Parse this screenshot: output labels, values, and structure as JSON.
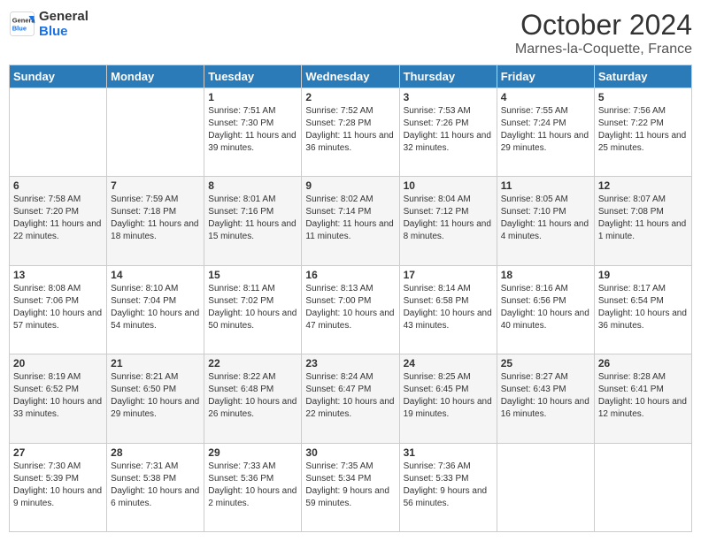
{
  "logo": {
    "line1": "General",
    "line2": "Blue"
  },
  "header": {
    "month": "October 2024",
    "location": "Marnes-la-Coquette, France"
  },
  "weekdays": [
    "Sunday",
    "Monday",
    "Tuesday",
    "Wednesday",
    "Thursday",
    "Friday",
    "Saturday"
  ],
  "weeks": [
    [
      {
        "day": "",
        "sunrise": "",
        "sunset": "",
        "daylight": ""
      },
      {
        "day": "",
        "sunrise": "",
        "sunset": "",
        "daylight": ""
      },
      {
        "day": "1",
        "sunrise": "Sunrise: 7:51 AM",
        "sunset": "Sunset: 7:30 PM",
        "daylight": "Daylight: 11 hours and 39 minutes."
      },
      {
        "day": "2",
        "sunrise": "Sunrise: 7:52 AM",
        "sunset": "Sunset: 7:28 PM",
        "daylight": "Daylight: 11 hours and 36 minutes."
      },
      {
        "day": "3",
        "sunrise": "Sunrise: 7:53 AM",
        "sunset": "Sunset: 7:26 PM",
        "daylight": "Daylight: 11 hours and 32 minutes."
      },
      {
        "day": "4",
        "sunrise": "Sunrise: 7:55 AM",
        "sunset": "Sunset: 7:24 PM",
        "daylight": "Daylight: 11 hours and 29 minutes."
      },
      {
        "day": "5",
        "sunrise": "Sunrise: 7:56 AM",
        "sunset": "Sunset: 7:22 PM",
        "daylight": "Daylight: 11 hours and 25 minutes."
      }
    ],
    [
      {
        "day": "6",
        "sunrise": "Sunrise: 7:58 AM",
        "sunset": "Sunset: 7:20 PM",
        "daylight": "Daylight: 11 hours and 22 minutes."
      },
      {
        "day": "7",
        "sunrise": "Sunrise: 7:59 AM",
        "sunset": "Sunset: 7:18 PM",
        "daylight": "Daylight: 11 hours and 18 minutes."
      },
      {
        "day": "8",
        "sunrise": "Sunrise: 8:01 AM",
        "sunset": "Sunset: 7:16 PM",
        "daylight": "Daylight: 11 hours and 15 minutes."
      },
      {
        "day": "9",
        "sunrise": "Sunrise: 8:02 AM",
        "sunset": "Sunset: 7:14 PM",
        "daylight": "Daylight: 11 hours and 11 minutes."
      },
      {
        "day": "10",
        "sunrise": "Sunrise: 8:04 AM",
        "sunset": "Sunset: 7:12 PM",
        "daylight": "Daylight: 11 hours and 8 minutes."
      },
      {
        "day": "11",
        "sunrise": "Sunrise: 8:05 AM",
        "sunset": "Sunset: 7:10 PM",
        "daylight": "Daylight: 11 hours and 4 minutes."
      },
      {
        "day": "12",
        "sunrise": "Sunrise: 8:07 AM",
        "sunset": "Sunset: 7:08 PM",
        "daylight": "Daylight: 11 hours and 1 minute."
      }
    ],
    [
      {
        "day": "13",
        "sunrise": "Sunrise: 8:08 AM",
        "sunset": "Sunset: 7:06 PM",
        "daylight": "Daylight: 10 hours and 57 minutes."
      },
      {
        "day": "14",
        "sunrise": "Sunrise: 8:10 AM",
        "sunset": "Sunset: 7:04 PM",
        "daylight": "Daylight: 10 hours and 54 minutes."
      },
      {
        "day": "15",
        "sunrise": "Sunrise: 8:11 AM",
        "sunset": "Sunset: 7:02 PM",
        "daylight": "Daylight: 10 hours and 50 minutes."
      },
      {
        "day": "16",
        "sunrise": "Sunrise: 8:13 AM",
        "sunset": "Sunset: 7:00 PM",
        "daylight": "Daylight: 10 hours and 47 minutes."
      },
      {
        "day": "17",
        "sunrise": "Sunrise: 8:14 AM",
        "sunset": "Sunset: 6:58 PM",
        "daylight": "Daylight: 10 hours and 43 minutes."
      },
      {
        "day": "18",
        "sunrise": "Sunrise: 8:16 AM",
        "sunset": "Sunset: 6:56 PM",
        "daylight": "Daylight: 10 hours and 40 minutes."
      },
      {
        "day": "19",
        "sunrise": "Sunrise: 8:17 AM",
        "sunset": "Sunset: 6:54 PM",
        "daylight": "Daylight: 10 hours and 36 minutes."
      }
    ],
    [
      {
        "day": "20",
        "sunrise": "Sunrise: 8:19 AM",
        "sunset": "Sunset: 6:52 PM",
        "daylight": "Daylight: 10 hours and 33 minutes."
      },
      {
        "day": "21",
        "sunrise": "Sunrise: 8:21 AM",
        "sunset": "Sunset: 6:50 PM",
        "daylight": "Daylight: 10 hours and 29 minutes."
      },
      {
        "day": "22",
        "sunrise": "Sunrise: 8:22 AM",
        "sunset": "Sunset: 6:48 PM",
        "daylight": "Daylight: 10 hours and 26 minutes."
      },
      {
        "day": "23",
        "sunrise": "Sunrise: 8:24 AM",
        "sunset": "Sunset: 6:47 PM",
        "daylight": "Daylight: 10 hours and 22 minutes."
      },
      {
        "day": "24",
        "sunrise": "Sunrise: 8:25 AM",
        "sunset": "Sunset: 6:45 PM",
        "daylight": "Daylight: 10 hours and 19 minutes."
      },
      {
        "day": "25",
        "sunrise": "Sunrise: 8:27 AM",
        "sunset": "Sunset: 6:43 PM",
        "daylight": "Daylight: 10 hours and 16 minutes."
      },
      {
        "day": "26",
        "sunrise": "Sunrise: 8:28 AM",
        "sunset": "Sunset: 6:41 PM",
        "daylight": "Daylight: 10 hours and 12 minutes."
      }
    ],
    [
      {
        "day": "27",
        "sunrise": "Sunrise: 7:30 AM",
        "sunset": "Sunset: 5:39 PM",
        "daylight": "Daylight: 10 hours and 9 minutes."
      },
      {
        "day": "28",
        "sunrise": "Sunrise: 7:31 AM",
        "sunset": "Sunset: 5:38 PM",
        "daylight": "Daylight: 10 hours and 6 minutes."
      },
      {
        "day": "29",
        "sunrise": "Sunrise: 7:33 AM",
        "sunset": "Sunset: 5:36 PM",
        "daylight": "Daylight: 10 hours and 2 minutes."
      },
      {
        "day": "30",
        "sunrise": "Sunrise: 7:35 AM",
        "sunset": "Sunset: 5:34 PM",
        "daylight": "Daylight: 9 hours and 59 minutes."
      },
      {
        "day": "31",
        "sunrise": "Sunrise: 7:36 AM",
        "sunset": "Sunset: 5:33 PM",
        "daylight": "Daylight: 9 hours and 56 minutes."
      },
      {
        "day": "",
        "sunrise": "",
        "sunset": "",
        "daylight": ""
      },
      {
        "day": "",
        "sunrise": "",
        "sunset": "",
        "daylight": ""
      }
    ]
  ]
}
